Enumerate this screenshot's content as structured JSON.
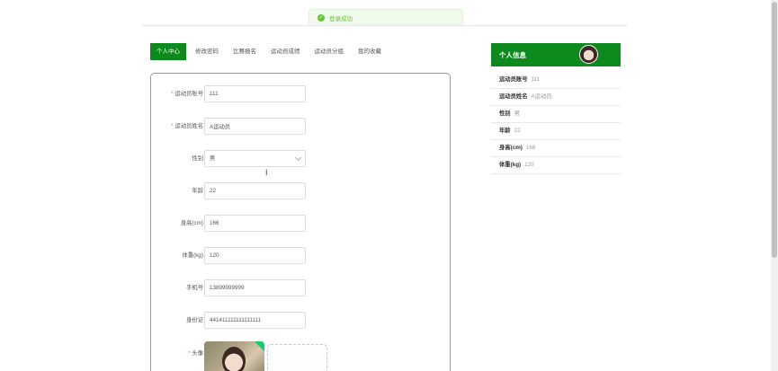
{
  "toast": {
    "message": "登录成功",
    "icon": "check-circle-icon"
  },
  "tabs": [
    {
      "label": "个人中心",
      "active": true
    },
    {
      "label": "修改密码",
      "active": false
    },
    {
      "label": "比赛报名",
      "active": false
    },
    {
      "label": "运动员成绩",
      "active": false
    },
    {
      "label": "运动员分组",
      "active": false
    },
    {
      "label": "我的收藏",
      "active": false
    }
  ],
  "form": {
    "account": {
      "label": "运动员账号",
      "value": "111"
    },
    "name": {
      "label": "运动员姓名",
      "value": "A运动员"
    },
    "gender": {
      "label": "性别",
      "value": "男"
    },
    "age": {
      "label": "年龄",
      "value": "22"
    },
    "height": {
      "label": "身高(cm)",
      "value": "166"
    },
    "weight": {
      "label": "体重(kg)",
      "value": "120"
    },
    "phone": {
      "label": "手机号",
      "value": "13899999999"
    },
    "idcard": {
      "label": "身份证",
      "value": "441411111111111111"
    },
    "avatar": {
      "label": "头像",
      "upload_symbol": "+"
    }
  },
  "panel": {
    "title": "个人信息",
    "items": [
      {
        "key": "运动员账号",
        "value": "111"
      },
      {
        "key": "运动员姓名",
        "value": "A运动员"
      },
      {
        "key": "性别",
        "value": "男"
      },
      {
        "key": "年龄",
        "value": "22"
      },
      {
        "key": "身高(cm)",
        "value": "166"
      },
      {
        "key": "体重(kg)",
        "value": "120"
      }
    ]
  },
  "colors": {
    "accent": "#0c8a1e",
    "success": "#67c23a",
    "required": "#f56c6c"
  }
}
